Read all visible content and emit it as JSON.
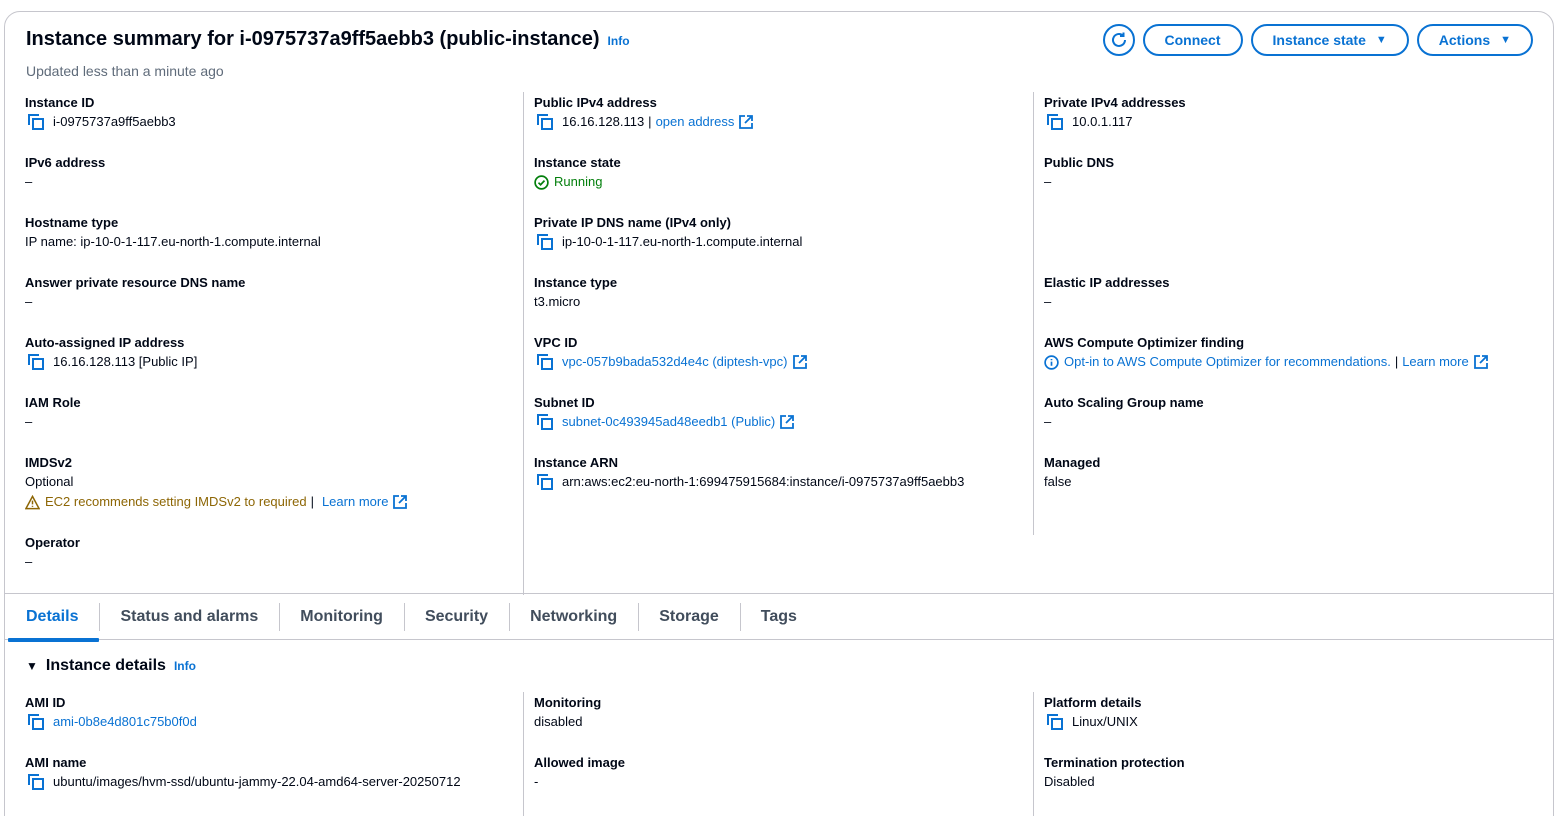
{
  "header": {
    "title": "Instance summary for i-0975737a9ff5aebb3 (public-instance)",
    "info": "Info",
    "updated": "Updated less than a minute ago",
    "connect": "Connect",
    "instance_state": "Instance state",
    "actions": "Actions"
  },
  "summary": {
    "instance_id": {
      "label": "Instance ID",
      "value": "i-0975737a9ff5aebb3"
    },
    "ipv6": {
      "label": "IPv6 address",
      "value": "–"
    },
    "hostname_type": {
      "label": "Hostname type",
      "value": "IP name: ip-10-0-1-117.eu-north-1.compute.internal"
    },
    "answer_dns": {
      "label": "Answer private resource DNS name",
      "value": "–"
    },
    "auto_ip": {
      "label": "Auto-assigned IP address",
      "value": "16.16.128.113 [Public IP]"
    },
    "iam_role": {
      "label": "IAM Role",
      "value": "–"
    },
    "imdsv2": {
      "label": "IMDSv2",
      "value": "Optional",
      "warning": "EC2 recommends setting IMDSv2 to required",
      "sep": "|",
      "learn_more": "Learn more"
    },
    "operator": {
      "label": "Operator",
      "value": "–"
    },
    "public_ipv4": {
      "label": "Public IPv4 address",
      "value": "16.16.128.113",
      "sep": "|",
      "link": "open address"
    },
    "instance_state": {
      "label": "Instance state",
      "value": "Running"
    },
    "private_dns": {
      "label": "Private IP DNS name (IPv4 only)",
      "value": "ip-10-0-1-117.eu-north-1.compute.internal"
    },
    "instance_type": {
      "label": "Instance type",
      "value": "t3.micro"
    },
    "vpc_id": {
      "label": "VPC ID",
      "value": "vpc-057b9bada532d4e4c (diptesh-vpc)"
    },
    "subnet_id": {
      "label": "Subnet ID",
      "value": "subnet-0c493945ad48eedb1 (Public)"
    },
    "arn": {
      "label": "Instance ARN",
      "value": "arn:aws:ec2:eu-north-1:699475915684:instance/i-0975737a9ff5aebb3"
    },
    "private_ipv4": {
      "label": "Private IPv4 addresses",
      "value": "10.0.1.117"
    },
    "public_dns": {
      "label": "Public DNS",
      "value": "–"
    },
    "elastic_ip": {
      "label": "Elastic IP addresses",
      "value": "–"
    },
    "optimizer": {
      "label": "AWS Compute Optimizer finding",
      "link": "Opt-in to AWS Compute Optimizer for recommendations.",
      "sep": "|",
      "learn_more": "Learn more"
    },
    "asg": {
      "label": "Auto Scaling Group name",
      "value": "–"
    },
    "managed": {
      "label": "Managed",
      "value": "false"
    }
  },
  "tabs": [
    "Details",
    "Status and alarms",
    "Monitoring",
    "Security",
    "Networking",
    "Storage",
    "Tags"
  ],
  "details": {
    "title": "Instance details",
    "info": "Info",
    "ami_id": {
      "label": "AMI ID",
      "value": "ami-0b8e4d801c75b0f0d"
    },
    "ami_name": {
      "label": "AMI name",
      "value": "ubuntu/images/hvm-ssd/ubuntu-jammy-22.04-amd64-server-20250712"
    },
    "monitoring": {
      "label": "Monitoring",
      "value": "disabled"
    },
    "allowed_image": {
      "label": "Allowed image",
      "value": "-"
    },
    "platform": {
      "label": "Platform details",
      "value": "Linux/UNIX"
    },
    "termination": {
      "label": "Termination protection",
      "value": "Disabled"
    }
  },
  "colors": {
    "accent": "#0972d3",
    "success": "#037f0c",
    "warning": "#8d6605",
    "border": "#c6c6cd"
  }
}
